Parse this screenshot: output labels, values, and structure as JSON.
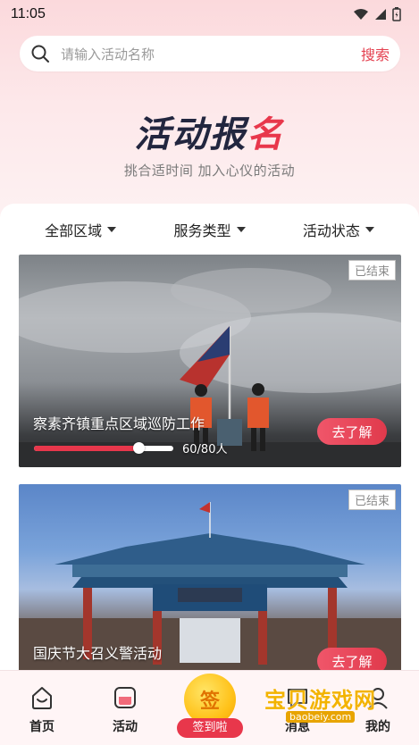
{
  "status_bar": {
    "time": "11:05"
  },
  "search": {
    "placeholder": "请输入活动名称",
    "button_label": "搜索"
  },
  "hero": {
    "title_main": "活动报",
    "title_accent": "名",
    "subtitle": "挑合适时间   加入心仪的活动"
  },
  "filters": [
    {
      "label": "全部区域"
    },
    {
      "label": "服务类型"
    },
    {
      "label": "活动状态"
    }
  ],
  "activities": [
    {
      "title": "察素齐镇重点区域巡防工作",
      "status": "已结束",
      "progress_text": "60/80人",
      "progress_fraction": 0.75,
      "action_label": "去了解"
    },
    {
      "title": "国庆节大召义警活动",
      "status": "已结束",
      "action_label": "去了解"
    }
  ],
  "tabbar": {
    "home": "首页",
    "activity": "活动",
    "signin_glyph": "签",
    "signin_label": "签到啦",
    "message": "消息",
    "mine": "我的"
  },
  "watermark": {
    "text": "宝贝游戏网",
    "url": "baobeiy.com"
  },
  "colors": {
    "accent": "#e8374b",
    "coin": "#ffc21a"
  }
}
